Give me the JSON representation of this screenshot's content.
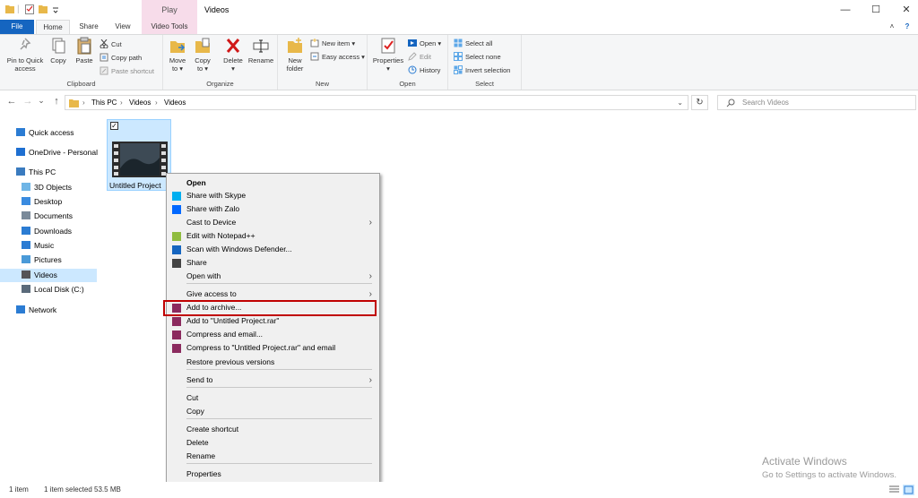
{
  "titlebar": {
    "context_tab": "Play",
    "title": "Videos",
    "minimize": "—",
    "maximize": "☐",
    "close": "✕",
    "help_glyph": "?",
    "caret_glyph": "˄"
  },
  "tabs": {
    "file": "File",
    "home": "Home",
    "share": "Share",
    "view": "View",
    "video_tools": "Video Tools"
  },
  "ribbon": {
    "clipboard": {
      "label": "Clipboard",
      "pin": [
        "Pin to Quick",
        "access"
      ],
      "copy": "Copy",
      "paste": "Paste",
      "cut": "Cut",
      "copy_path": "Copy path",
      "paste_shortcut": "Paste shortcut"
    },
    "organize": {
      "label": "Organize",
      "move_to": [
        "Move",
        "to ▾"
      ],
      "copy_to": [
        "Copy",
        "to ▾"
      ],
      "delete": [
        "Delete",
        "▾"
      ],
      "rename": "Rename"
    },
    "new": {
      "label": "New",
      "new_folder": [
        "New",
        "folder"
      ],
      "new_item": "New item ▾",
      "easy_access": "Easy access ▾"
    },
    "open": {
      "label": "Open",
      "properties": [
        "Properties",
        "▾"
      ],
      "open": "Open ▾",
      "edit": "Edit",
      "history": "History"
    },
    "select": {
      "label": "Select",
      "select_all": "Select all",
      "select_none": "Select none",
      "invert": "Invert selection"
    }
  },
  "nav": {
    "back": "←",
    "forward": "→",
    "recent": "⌄",
    "up": "↑",
    "breadcrumb": [
      "This PC",
      "Videos",
      "Videos"
    ],
    "sep": "›",
    "dropdown": "⌄",
    "refresh": "↻",
    "search_placeholder": "Search Videos"
  },
  "sidebar": {
    "items": [
      {
        "label": "Quick access",
        "icon": "star-icon",
        "color": "#2b7cd3"
      },
      {
        "label": "OneDrive - Personal",
        "icon": "cloud-icon",
        "color": "#1e6fd1"
      },
      {
        "label": "This PC",
        "icon": "computer-icon",
        "color": "#3a7bbf"
      },
      {
        "label": "3D Objects",
        "icon": "cube-icon",
        "color": "#6fb5e6"
      },
      {
        "label": "Desktop",
        "icon": "desktop-icon",
        "color": "#3a8be0"
      },
      {
        "label": "Documents",
        "icon": "document-icon",
        "color": "#7a8a9a"
      },
      {
        "label": "Downloads",
        "icon": "download-icon",
        "color": "#2b7cd3"
      },
      {
        "label": "Music",
        "icon": "music-icon",
        "color": "#2b7cd3"
      },
      {
        "label": "Pictures",
        "icon": "pictures-icon",
        "color": "#4a9ad8"
      },
      {
        "label": "Videos",
        "icon": "videos-icon",
        "color": "#555555"
      },
      {
        "label": "Local Disk (C:)",
        "icon": "drive-icon",
        "color": "#5a6a7a"
      },
      {
        "label": "Network",
        "icon": "network-icon",
        "color": "#2b7cd3"
      }
    ]
  },
  "file": {
    "name": "Untitled Project",
    "checked": "✓"
  },
  "context_menu": {
    "items": [
      {
        "label": "Open",
        "bold": true
      },
      {
        "label": "Share with Skype",
        "icon": "skype-icon",
        "color": "#00aff0"
      },
      {
        "label": "Share with Zalo",
        "icon": "zalo-icon",
        "color": "#0068ff"
      },
      {
        "label": "Cast to Device",
        "submenu": true
      },
      {
        "label": "Edit with Notepad++",
        "icon": "notepad-plus-icon",
        "color": "#8fbc3f"
      },
      {
        "label": "Scan with Windows Defender...",
        "icon": "defender-icon",
        "color": "#1565c0"
      },
      {
        "label": "Share",
        "icon": "share-icon",
        "color": "#444444"
      },
      {
        "label": "Open with",
        "submenu": true
      },
      {
        "label": "Give access to",
        "submenu": true
      },
      {
        "label": "Add to archive...",
        "icon": "winrar-icon",
        "color": "#8b2a5e"
      },
      {
        "label": "Add to \"Untitled Project.rar\"",
        "icon": "winrar-icon",
        "color": "#8b2a5e"
      },
      {
        "label": "Compress and email...",
        "icon": "winrar-icon",
        "color": "#8b2a5e"
      },
      {
        "label": "Compress to \"Untitled Project.rar\" and email",
        "icon": "winrar-icon",
        "color": "#8b2a5e"
      },
      {
        "label": "Restore previous versions"
      },
      {
        "label": "Send to",
        "submenu": true
      },
      {
        "label": "Cut"
      },
      {
        "label": "Copy"
      },
      {
        "label": "Create shortcut"
      },
      {
        "label": "Delete"
      },
      {
        "label": "Rename"
      },
      {
        "label": "Properties"
      }
    ],
    "submenu_arrow": "›"
  },
  "status": {
    "count": "1 item",
    "selected": "1 item selected  53.5 MB"
  },
  "activation": {
    "line1": "Activate Windows",
    "line2": "Go to Settings to activate Windows."
  },
  "colors": {
    "accent": "#1565c0",
    "selection": "#cce8ff",
    "highlight_box": "#c00000",
    "folder": "#e8b84a"
  }
}
